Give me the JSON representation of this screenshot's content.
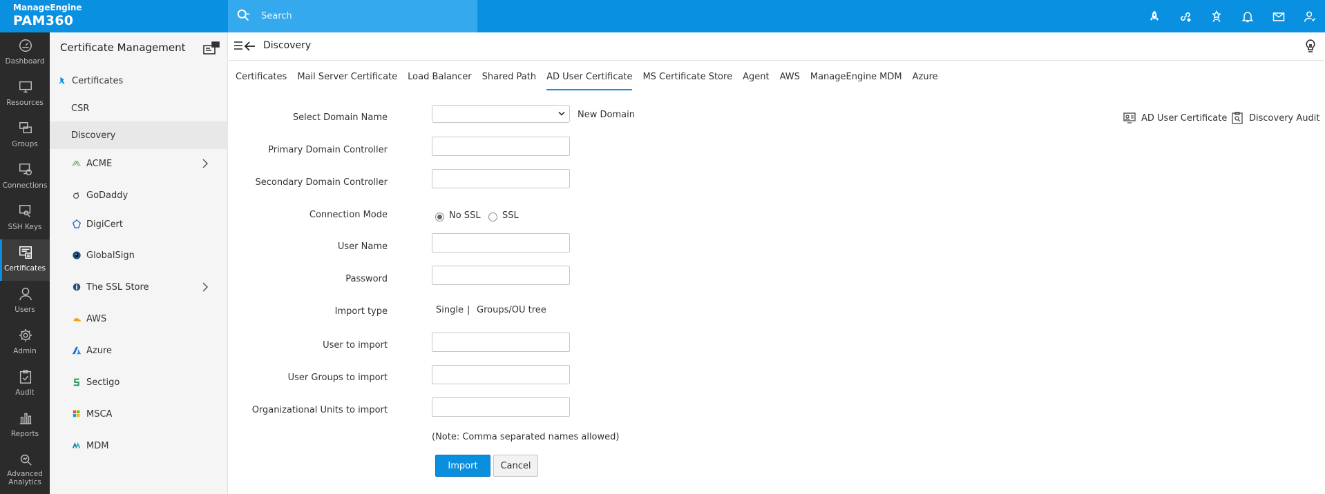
{
  "brand": {
    "company": "ManageEngine",
    "product": "PAM360"
  },
  "search": {
    "placeholder": "Search"
  },
  "top_icons": [
    "rocket-icon",
    "link-settings-icon",
    "star-person-icon",
    "bell-icon",
    "mail-icon",
    "user-icon"
  ],
  "rail": [
    {
      "label": "Dashboard",
      "icon": "dashboard-icon"
    },
    {
      "label": "Resources",
      "icon": "monitor-icon"
    },
    {
      "label": "Groups",
      "icon": "groups-icon"
    },
    {
      "label": "Connections",
      "icon": "connections-icon"
    },
    {
      "label": "SSH Keys",
      "icon": "ssh-key-icon"
    },
    {
      "label": "Certificates",
      "icon": "certificate-icon",
      "active": true
    },
    {
      "label": "Users",
      "icon": "user-icon"
    },
    {
      "label": "Admin",
      "icon": "gear-icon"
    },
    {
      "label": "Audit",
      "icon": "audit-icon"
    },
    {
      "label": "Reports",
      "icon": "reports-icon"
    },
    {
      "label": "Advanced",
      "label2": "Analytics",
      "icon": "analytics-icon"
    }
  ],
  "sidebar": {
    "title": "Certificate Management",
    "items": [
      {
        "label": "Certificates",
        "icon": "pin-icon"
      },
      {
        "label": "CSR"
      },
      {
        "label": "Discovery",
        "active": true
      },
      {
        "label": "ACME",
        "icon": "acme-icon",
        "expandable": true
      },
      {
        "label": "GoDaddy",
        "icon": "godaddy-icon"
      },
      {
        "label": "DigiCert",
        "icon": "digicert-icon"
      },
      {
        "label": "GlobalSign",
        "icon": "globalsign-icon"
      },
      {
        "label": "The SSL Store",
        "icon": "sslstore-icon",
        "expandable": true
      },
      {
        "label": "AWS",
        "icon": "aws-icon"
      },
      {
        "label": "Azure",
        "icon": "azure-icon"
      },
      {
        "label": "Sectigo",
        "icon": "sectigo-icon"
      },
      {
        "label": "MSCA",
        "icon": "msca-icon"
      },
      {
        "label": "MDM",
        "icon": "mdm-icon"
      }
    ]
  },
  "main": {
    "title": "Discovery",
    "tabs": [
      {
        "label": "Certificates"
      },
      {
        "label": "Mail Server Certificate"
      },
      {
        "label": "Load Balancer"
      },
      {
        "label": "Shared Path"
      },
      {
        "label": "AD User Certificate",
        "active": true
      },
      {
        "label": "MS Certificate Store"
      },
      {
        "label": "Agent"
      },
      {
        "label": "AWS"
      },
      {
        "label": "ManageEngine MDM"
      },
      {
        "label": "Azure"
      }
    ],
    "right_links": {
      "ad_user_certificate": "AD User Certificate",
      "discovery_audit": "Discovery Audit"
    },
    "form": {
      "select_domain_label": "Select Domain Name",
      "select_domain_value": "",
      "new_domain": "New Domain",
      "primary_dc_label": "Primary Domain Controller",
      "primary_dc_value": "",
      "secondary_dc_label": "Secondary Domain Controller",
      "secondary_dc_value": "",
      "connection_mode_label": "Connection Mode",
      "connection_no_ssl": "No SSL",
      "connection_ssl": "SSL",
      "connection_mode_selected": "No SSL",
      "username_label": "User Name",
      "username_value": "",
      "password_label": "Password",
      "password_value": "",
      "import_type_label": "Import type",
      "import_single": "Single",
      "import_sep": "|",
      "import_groups": "Groups/OU tree",
      "user_import_label": "User to import",
      "user_import_value": "",
      "groups_import_label": "User Groups to import",
      "groups_import_value": "",
      "ou_import_label": "Organizational Units to import",
      "ou_import_value": "",
      "note": "(Note: Comma separated names allowed)",
      "import_button": "Import",
      "cancel_button": "Cancel"
    }
  },
  "colors": {
    "accent": "#0a90e0",
    "rail_bg": "#2b2b2b",
    "sidebar_bg": "#f5f5f5"
  }
}
